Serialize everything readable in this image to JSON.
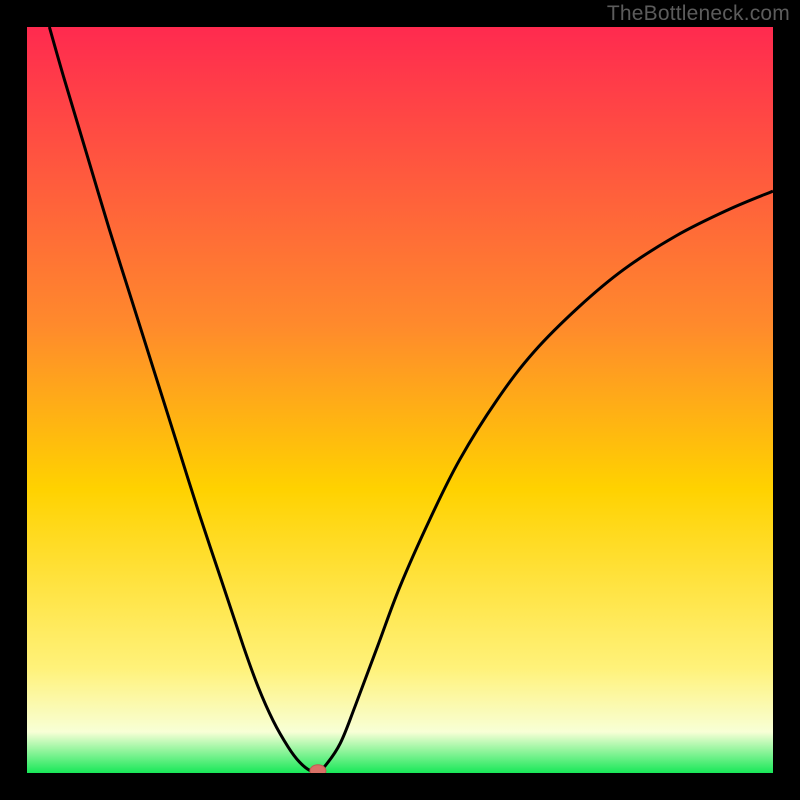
{
  "attribution": "TheBottleneck.com",
  "colors": {
    "background": "#000000",
    "gradient_top": "#ff2a4f",
    "gradient_mid_upper": "#ff8a2c",
    "gradient_mid": "#ffd200",
    "gradient_lower": "#fff27a",
    "gradient_pale": "#f8ffd6",
    "gradient_bottom": "#18e858",
    "curve": "#000000",
    "marker_fill": "#d97066",
    "marker_stroke": "#c05a52"
  },
  "chart_data": {
    "type": "line",
    "title": "",
    "xlabel": "",
    "ylabel": "",
    "x_range": [
      0,
      100
    ],
    "y_range": [
      0,
      100
    ],
    "series": [
      {
        "name": "bottleneck-curve",
        "x": [
          3,
          5,
          8,
          11,
          14,
          17,
          20,
          23,
          26,
          29,
          31,
          33,
          35,
          36.5,
          38,
          39,
          40,
          42,
          44,
          47,
          50,
          54,
          58,
          63,
          68,
          74,
          80,
          87,
          94,
          100
        ],
        "y": [
          100,
          93,
          83,
          73,
          63.5,
          54,
          44.5,
          35,
          26,
          17,
          11.5,
          7,
          3.5,
          1.5,
          0.3,
          0.3,
          1,
          4,
          9,
          17,
          25,
          34,
          42,
          50,
          56.5,
          62.5,
          67.5,
          72,
          75.5,
          78
        ]
      }
    ],
    "marker": {
      "x": 39,
      "y": 0.3
    },
    "gradient_stops": [
      {
        "offset": 0.0,
        "key": "gradient_top"
      },
      {
        "offset": 0.4,
        "key": "gradient_mid_upper"
      },
      {
        "offset": 0.62,
        "key": "gradient_mid"
      },
      {
        "offset": 0.86,
        "key": "gradient_lower"
      },
      {
        "offset": 0.945,
        "key": "gradient_pale"
      },
      {
        "offset": 1.0,
        "key": "gradient_bottom"
      }
    ]
  }
}
